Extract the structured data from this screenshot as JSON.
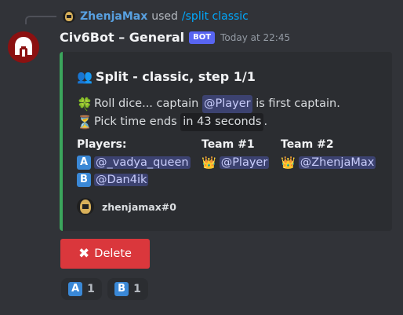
{
  "reply": {
    "user": "ZhenjaMax",
    "used": "used",
    "command": "/split classic"
  },
  "message": {
    "author": "Civ6Bot – General",
    "bot_badge": "BOT",
    "timestamp": "Today at 22:45"
  },
  "embed": {
    "accent_color": "#3ba55c",
    "title_emoji": "👥",
    "title": "Split - classic, step 1/1",
    "line1": {
      "emoji": "🍀",
      "prefix": "Roll dice... captain",
      "mention": "@Player",
      "suffix": "is first captain."
    },
    "line2": {
      "emoji": "⏳",
      "prefix": "Pick time ends",
      "code": "in 43 seconds",
      "suffix": "."
    },
    "fields": {
      "players": {
        "name": "Players:",
        "entries": [
          {
            "badge": "A",
            "mention": "@_vadya_queen"
          },
          {
            "badge": "B",
            "mention": "@Dan4ik"
          }
        ]
      },
      "team1": {
        "name": "Team #1",
        "icon": "👑",
        "mention": "@Player"
      },
      "team2": {
        "name": "Team #2",
        "icon": "👑",
        "mention": "@ZhenjaMax"
      }
    },
    "footer": "zhenjamax#0"
  },
  "delete_button": {
    "icon": "✖",
    "label": "Delete"
  },
  "reactions": [
    {
      "badge": "A",
      "count": "1"
    },
    {
      "badge": "B",
      "count": "1"
    }
  ]
}
